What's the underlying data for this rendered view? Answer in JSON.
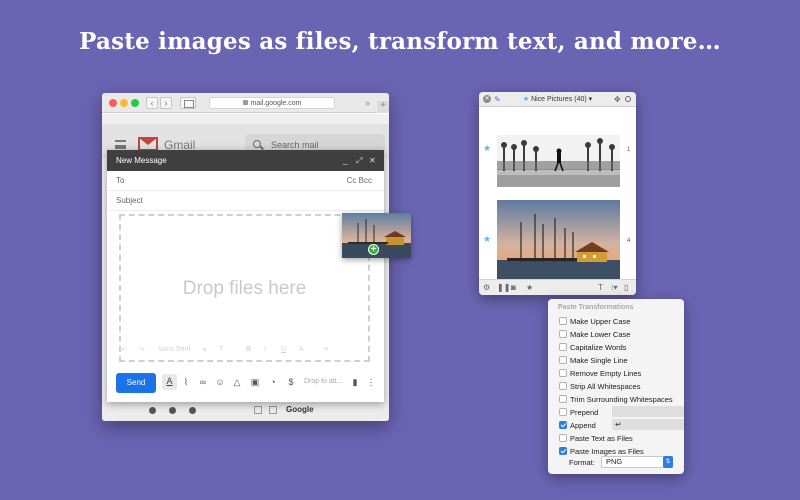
{
  "headline": "Paste images as files, transform text, and more…",
  "browser": {
    "url": "mail.google.com",
    "gmail_word": "Gmail",
    "search_placeholder": "Search mail",
    "footer_sender": "Google"
  },
  "compose": {
    "title": "New Message",
    "to_label": "To",
    "cc_bcc": "Cc Bcc",
    "subject_label": "Subject",
    "drop_text": "Drop files here",
    "font_label": "Sans Serif",
    "send_label": "Send",
    "drop_attach_text": "Drop to att..."
  },
  "panel": {
    "title": "Nice Pictures (40)",
    "items": [
      {
        "index": "1"
      },
      {
        "index": "4"
      }
    ]
  },
  "menu": {
    "header": "Paste Transformations",
    "items": [
      {
        "label": "Make Upper Case",
        "checked": false
      },
      {
        "label": "Make Lower Case",
        "checked": false
      },
      {
        "label": "Capitalize Words",
        "checked": false
      },
      {
        "label": "Make Single Line",
        "checked": false
      },
      {
        "label": "Remove Empty Lines",
        "checked": false
      },
      {
        "label": "Strip All Whitespaces",
        "checked": false
      },
      {
        "label": "Trim Surrounding Whitespaces",
        "checked": false
      },
      {
        "label": "Prepend",
        "checked": false,
        "field": ""
      },
      {
        "label": "Append",
        "checked": true,
        "field": "↵"
      },
      {
        "label": "Paste Text as Files",
        "checked": false
      },
      {
        "label": "Paste Images as Files",
        "checked": true
      }
    ],
    "format_label": "Format:",
    "format_value": "PNG"
  },
  "colors": {
    "background": "#6a64b3",
    "accent": "#2f7de1",
    "send": "#1a73e8",
    "star": "#5fb3e6"
  }
}
